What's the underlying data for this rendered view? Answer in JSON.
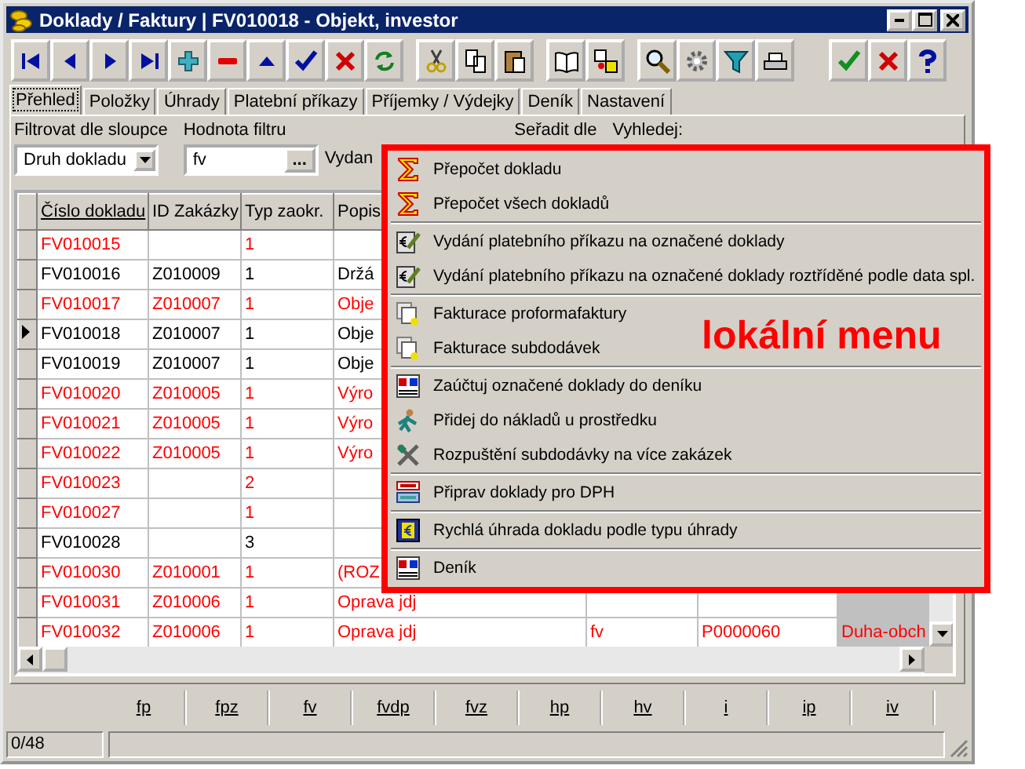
{
  "window": {
    "title": "Doklady / Faktury | FV010018 - Objekt, investor"
  },
  "toolbar": {
    "groups": [
      [
        {
          "kind": "first"
        },
        {
          "kind": "prev"
        },
        {
          "kind": "next"
        },
        {
          "kind": "last"
        },
        {
          "kind": "add"
        },
        {
          "kind": "remove"
        },
        {
          "kind": "up"
        },
        {
          "kind": "confirm"
        },
        {
          "kind": "cancel"
        },
        {
          "kind": "refresh"
        }
      ],
      [
        {
          "kind": "cut"
        },
        {
          "kind": "copy"
        },
        {
          "kind": "paste"
        }
      ],
      [
        {
          "kind": "book"
        },
        {
          "kind": "shapes"
        }
      ],
      [
        {
          "kind": "search"
        },
        {
          "kind": "gear"
        },
        {
          "kind": "filter"
        },
        {
          "kind": "print"
        }
      ],
      [
        {
          "kind": "confirm"
        },
        {
          "kind": "cancel"
        },
        {
          "kind": "help"
        }
      ]
    ]
  },
  "tabs": [
    {
      "label": "Přehled",
      "selected": true
    },
    {
      "label": "Položky",
      "selected": false
    },
    {
      "label": "Úhrady",
      "selected": false
    },
    {
      "label": "Platební příkazy",
      "selected": false
    },
    {
      "label": "Příjemky / Výdejky",
      "selected": false
    },
    {
      "label": "Deník",
      "selected": false
    },
    {
      "label": "Nastavení",
      "selected": false
    }
  ],
  "filter": {
    "column_label": "Filtrovat dle sloupce",
    "column_value": "Druh dokladu",
    "value_label": "Hodnota filtru",
    "value": "fv",
    "button": "...",
    "label_3": "Vydan",
    "sort_label": "Seřadit dle",
    "search_label": "Vyhledej:"
  },
  "table": {
    "columns": [
      "Číslo dokladu",
      "ID Zakázky",
      "Typ zaokr.",
      "Popis"
    ],
    "rows": [
      {
        "color": "#ff0000",
        "current": false,
        "cells": [
          "FV010015",
          "",
          "1",
          "",
          "",
          "",
          ""
        ]
      },
      {
        "color": "#000000",
        "current": false,
        "cells": [
          "FV010016",
          "Z010009",
          "1",
          "Držá",
          "",
          "",
          ""
        ]
      },
      {
        "color": "#ff0000",
        "current": false,
        "cells": [
          "FV010017",
          "Z010007",
          "1",
          "Obje",
          "",
          "",
          ""
        ]
      },
      {
        "color": "#000000",
        "current": true,
        "cells": [
          "FV010018",
          "Z010007",
          "1",
          "Obje",
          "",
          "",
          ""
        ]
      },
      {
        "color": "#000000",
        "current": false,
        "cells": [
          "FV010019",
          "Z010007",
          "1",
          "Obje",
          "",
          "",
          ""
        ]
      },
      {
        "color": "#ff0000",
        "current": false,
        "cells": [
          "FV010020",
          "Z010005",
          "1",
          "Výro",
          "",
          "",
          ""
        ]
      },
      {
        "color": "#ff0000",
        "current": false,
        "cells": [
          "FV010021",
          "Z010005",
          "1",
          "Výro",
          "",
          "",
          ""
        ]
      },
      {
        "color": "#ff0000",
        "current": false,
        "cells": [
          "FV010022",
          "Z010005",
          "1",
          "Výro",
          "",
          "",
          ""
        ]
      },
      {
        "color": "#ff0000",
        "current": false,
        "cells": [
          "FV010023",
          "",
          "2",
          "",
          "",
          "",
          ""
        ]
      },
      {
        "color": "#ff0000",
        "current": false,
        "cells": [
          "FV010027",
          "",
          "1",
          "",
          "",
          "",
          ""
        ]
      },
      {
        "color": "#000000",
        "current": false,
        "cells": [
          "FV010028",
          "",
          "3",
          "",
          "",
          "",
          ""
        ]
      },
      {
        "color": "#ff0000",
        "current": false,
        "cells": [
          "FV010030",
          "Z010001",
          "1",
          "(ROZ",
          "",
          "",
          ""
        ]
      },
      {
        "color": "#ff0000",
        "current": false,
        "cells": [
          "FV010031",
          "Z010006",
          "1",
          "Oprava jdj",
          "",
          "",
          ""
        ]
      },
      {
        "color": "#ff0000",
        "current": false,
        "cells": [
          "FV010032",
          "Z010006",
          "1",
          "Oprava jdj",
          "fv",
          "P0000060",
          "Duha-obch"
        ]
      }
    ]
  },
  "letter_tabs": [
    "fp",
    "fpz",
    "fv",
    "fvdp",
    "fvz",
    "hp",
    "hv",
    "i",
    "ip",
    "iv"
  ],
  "status_bar": {
    "count": "0/48"
  },
  "context_menu": {
    "annotation": "lokální menu",
    "groups": [
      [
        {
          "kind": "sigma",
          "label": "Přepočet dokladu"
        },
        {
          "kind": "sigma",
          "label": "Přepočet všech dokladů"
        }
      ],
      [
        {
          "kind": "pen",
          "label": "Vydání platebního příkazu na označené doklady"
        },
        {
          "kind": "pen",
          "label": "Vydání platebního příkazu na označené doklady roztříděné podle data spl."
        }
      ],
      [
        {
          "kind": "pages",
          "label": "Fakturace proformafaktury"
        },
        {
          "kind": "pages",
          "label": "Fakturace subdodávek"
        }
      ],
      [
        {
          "kind": "ledger",
          "label": "Zaúčtuj označené doklady do deníku"
        },
        {
          "kind": "figure",
          "label": "Přidej do nákladů u prostředku"
        },
        {
          "kind": "tools",
          "label": "Rozpuštění subdodávky na více zakázek"
        }
      ],
      [
        {
          "kind": "dph",
          "label": "Připrav doklady pro DPH"
        }
      ],
      [
        {
          "kind": "euro",
          "label": "Rychlá úhrada dokladu podle typu úhrady"
        }
      ],
      [
        {
          "kind": "ledger",
          "label": "Deník"
        }
      ]
    ]
  }
}
